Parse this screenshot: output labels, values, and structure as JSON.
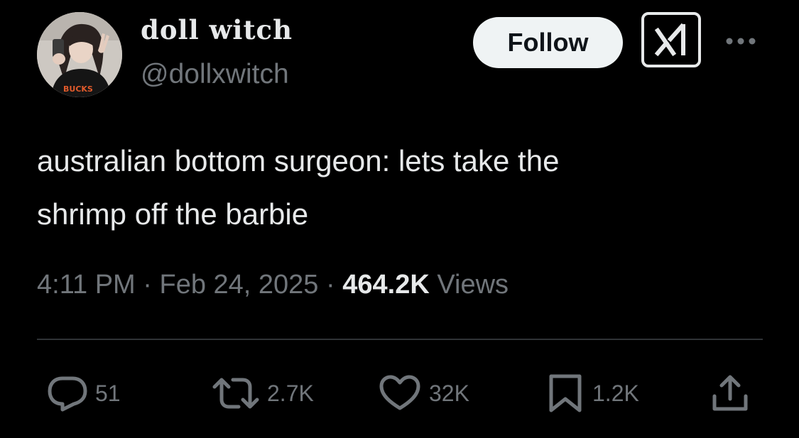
{
  "author": {
    "display_name": "doll witch",
    "handle": "@dollxwitch",
    "avatar_icon": "avatar-photo",
    "avatar_shirt_text": "BUCKS"
  },
  "header": {
    "follow_label": "Follow",
    "grok_icon": "grok-icon",
    "more_icon": "more-icon"
  },
  "tweet": {
    "text_lines": [
      "australian bottom surgeon: lets take the",
      "shrimp off the barbie"
    ]
  },
  "meta": {
    "time": "4:11 PM",
    "separator": "·",
    "date": "Feb 24, 2025",
    "views_count": "464.2K",
    "views_label": "Views"
  },
  "actions": {
    "reply": {
      "icon": "reply-icon",
      "count": "51"
    },
    "repost": {
      "icon": "repost-icon",
      "count": "2.7K"
    },
    "like": {
      "icon": "heart-icon",
      "count": "32K"
    },
    "bookmark": {
      "icon": "bookmark-icon",
      "count": "1.2K"
    },
    "share": {
      "icon": "share-icon"
    }
  },
  "colors": {
    "background": "#000000",
    "text_primary": "#e7e9ea",
    "text_secondary": "#71767b",
    "divider": "#2f3336",
    "follow_bg": "#eff3f4"
  }
}
